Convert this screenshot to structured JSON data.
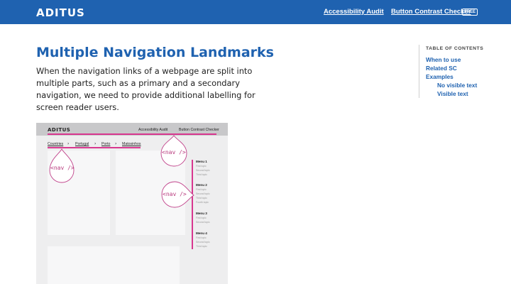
{
  "header": {
    "logo": "ADITUS",
    "nav": [
      {
        "label": "Accessibility Audit"
      },
      {
        "label": "Button Contrast Checker",
        "badge": "FREE"
      }
    ]
  },
  "main": {
    "title": "Multiple Navigation Landmarks",
    "intro": "When the navigation links of a webpage are split into multiple parts, such as a primary and a secondary navigation, we need to provide additional labelling for screen reader users."
  },
  "toc": {
    "title": "TABLE OF CONTENTS",
    "items": [
      {
        "label": "When to use"
      },
      {
        "label": "Related SC"
      },
      {
        "label": "Examples"
      },
      {
        "label": "No visible text"
      },
      {
        "label": "Visible text"
      }
    ]
  },
  "illustration": {
    "logo": "ADITUS",
    "nav": [
      "Accessibility Audit",
      "Button Contrast Checker"
    ],
    "breadcrumb": [
      "Countries",
      "Portugal",
      "Porto",
      "Matosinhos"
    ],
    "nav_label": "<nav />",
    "menus": [
      {
        "title": "Menu 1",
        "items": [
          "First topic",
          "Second topic",
          "Third topic"
        ]
      },
      {
        "title": "Menu 2",
        "items": [
          "First topic",
          "Second topic",
          "Third topic",
          "Fourth topic"
        ]
      },
      {
        "title": "Menu 3",
        "items": [
          "First topic",
          "Second topic"
        ]
      },
      {
        "title": "Menu 4",
        "items": [
          "First topic",
          "Second topic",
          "Third topic"
        ]
      }
    ],
    "colors": {
      "accent": "#d8378f",
      "header": "#1f62b0"
    }
  }
}
